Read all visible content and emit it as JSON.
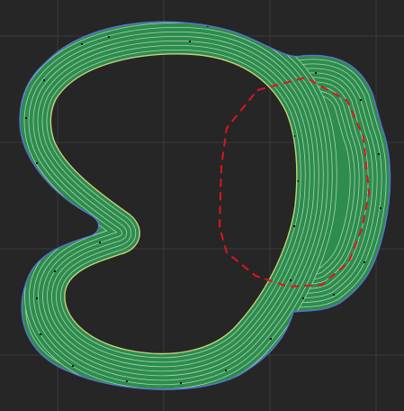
{
  "viewport": {
    "background": "#262626",
    "grid_color": "#3a3a3a"
  },
  "toolpath": {
    "fill_color": "#2d8c4e",
    "line_color": "#a9d5ae",
    "outer_wall_color": "#5a72d8",
    "inner_wall_color": "#c7d37a",
    "seam_color": "#101010"
  },
  "overlay": {
    "dash_color": "#e0141c"
  }
}
